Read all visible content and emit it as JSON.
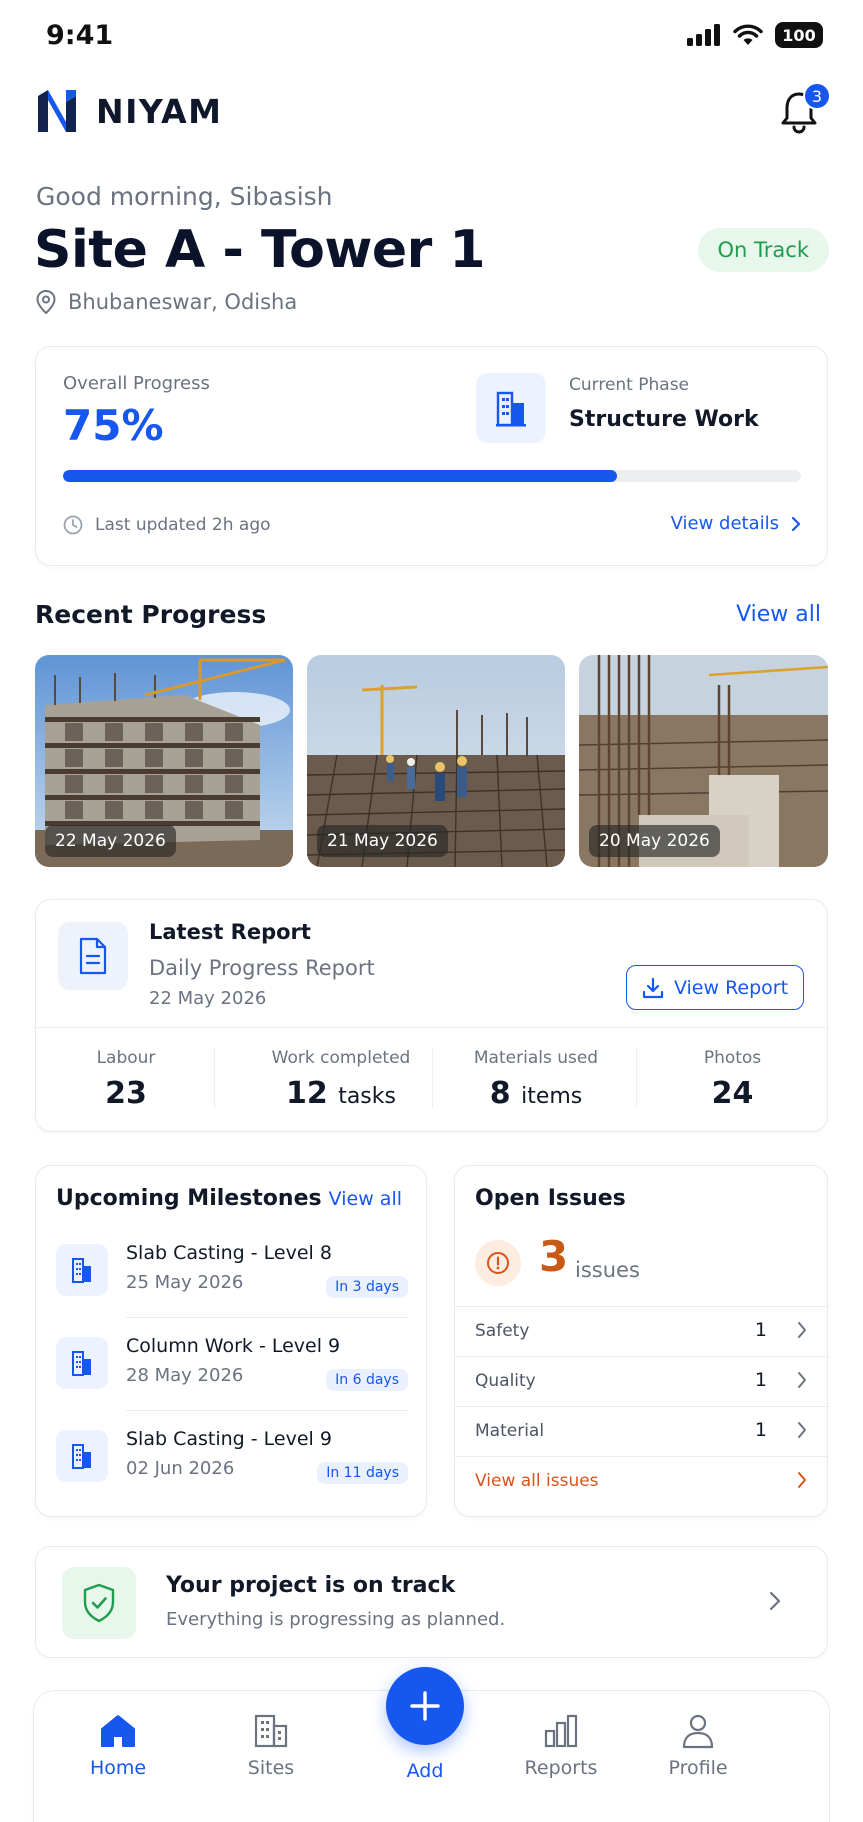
{
  "status": {
    "time": "9:41",
    "battery": "100"
  },
  "header": {
    "brand": "NIYAM",
    "notifications_count": "3"
  },
  "greeting": "Good morning, Sibasish",
  "site": {
    "title": "Site A - Tower 1",
    "location": "Bhubaneswar, Odisha",
    "status": "On Track"
  },
  "progress": {
    "label": "Overall Progress",
    "value": "75%",
    "value_fraction": 0.75,
    "phase_label": "Current Phase",
    "phase": "Structure Work",
    "updated": "Last updated 2h ago",
    "details_link": "View details"
  },
  "recent": {
    "title": "Recent Progress",
    "view_all": "View all",
    "photos": [
      {
        "date": "22 May 2026"
      },
      {
        "date": "21 May 2026"
      },
      {
        "date": "20 May 2026"
      }
    ]
  },
  "report": {
    "title": "Latest Report",
    "name": "Daily Progress Report",
    "date": "22 May 2026",
    "button": "View Report",
    "stats": [
      {
        "label": "Labour",
        "value": "23",
        "unit": ""
      },
      {
        "label": "Work completed",
        "value": "12",
        "unit": "tasks"
      },
      {
        "label": "Materials used",
        "value": "8",
        "unit": "items"
      },
      {
        "label": "Photos",
        "value": "24",
        "unit": ""
      }
    ]
  },
  "milestones": {
    "title": "Upcoming Milestones",
    "view_all": "View all",
    "items": [
      {
        "title": "Slab Casting - Level 8",
        "date": "25 May 2026",
        "badge": "In 3 days"
      },
      {
        "title": "Column Work - Level 9",
        "date": "28 May 2026",
        "badge": "In 6 days"
      },
      {
        "title": "Slab Casting - Level 9",
        "date": "02 Jun 2026",
        "badge": "In 11 days"
      }
    ]
  },
  "issues": {
    "title": "Open Issues",
    "count": "3",
    "count_label": "issues",
    "rows": [
      {
        "label": "Safety",
        "count": "1"
      },
      {
        "label": "Quality",
        "count": "1"
      },
      {
        "label": "Material",
        "count": "1"
      }
    ],
    "view_all": "View all issues"
  },
  "banner": {
    "title": "Your project is on track",
    "subtitle": "Everything is progressing as planned."
  },
  "nav": {
    "home": "Home",
    "sites": "Sites",
    "add": "Add",
    "reports": "Reports",
    "profile": "Profile"
  },
  "colors": {
    "primary": "#1657f0",
    "success": "#1f9d4c",
    "warning": "#c85a18"
  }
}
